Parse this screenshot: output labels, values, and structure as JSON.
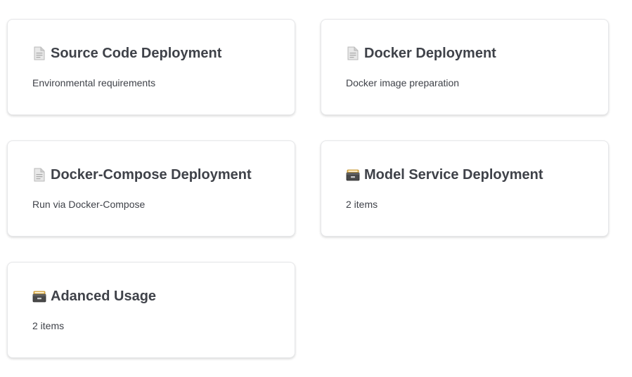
{
  "cards": [
    {
      "icon": "document-icon",
      "title": "Source Code Deployment",
      "description": "Environmental requirements"
    },
    {
      "icon": "document-icon",
      "title": "Docker Deployment",
      "description": "Docker image preparation"
    },
    {
      "icon": "document-icon",
      "title": "Docker-Compose Deployment",
      "description": "Run via Docker-Compose"
    },
    {
      "icon": "card-file-box-icon",
      "title": "Model Service Deployment",
      "description": "2 items"
    },
    {
      "icon": "card-file-box-icon",
      "title": "Adanced Usage",
      "description": "2 items"
    }
  ]
}
